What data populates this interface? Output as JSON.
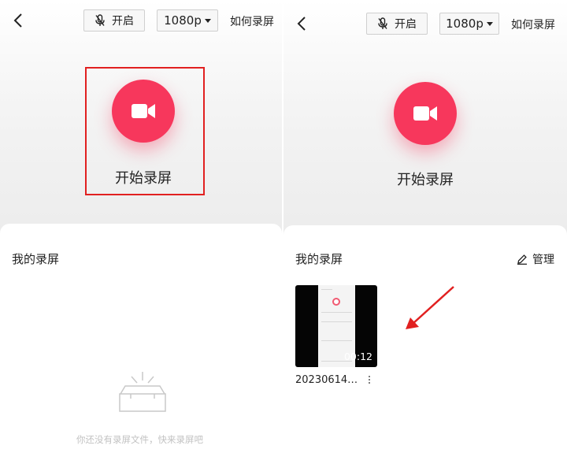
{
  "colors": {
    "accent": "#f7375c",
    "highlight": "#e12020",
    "text": "#222222",
    "muted": "#c2c2c2"
  },
  "left_panel": {
    "back_icon": "chevron-left-icon",
    "mic": {
      "icon": "microphone-icon",
      "label": "开启"
    },
    "resolution": {
      "label": "1080p",
      "icon": "caret-down-icon"
    },
    "how_to_label": "如何录屏",
    "record": {
      "icon": "video-camera-icon",
      "label": "开始录屏",
      "highlighted": true
    },
    "section_title": "我的录屏",
    "empty": {
      "icon": "empty-box-icon",
      "text": "你还没有录屏文件，快来录屏吧"
    }
  },
  "right_panel": {
    "back_icon": "chevron-left-icon",
    "mic": {
      "icon": "microphone-icon",
      "label": "开启"
    },
    "resolution": {
      "label": "1080p",
      "icon": "caret-down-icon"
    },
    "how_to_label": "如何录屏",
    "record": {
      "icon": "video-camera-icon",
      "label": "开始录屏"
    },
    "section_title": "我的录屏",
    "manage": {
      "icon": "edit-pencil-icon",
      "label": "管理"
    },
    "recordings": [
      {
        "name": "20230614…",
        "duration": "00:12",
        "more_icon": "more-vertical-icon"
      }
    ],
    "annotation_icon": "red-arrow-icon"
  }
}
